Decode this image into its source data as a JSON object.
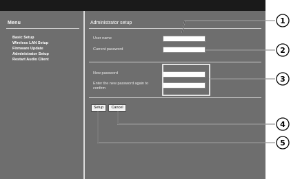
{
  "sidebar": {
    "title": "Menu",
    "items": [
      {
        "label": "Basic Setup"
      },
      {
        "label": "Wireless LAN Setup"
      },
      {
        "label": "Firmware Update"
      },
      {
        "label": "Administrator Setup"
      },
      {
        "label": "Restart Audio Client"
      }
    ]
  },
  "main": {
    "title": "Administrator setup",
    "fields": {
      "user_name": {
        "label": "User name",
        "value": ""
      },
      "current_password": {
        "label": "Current password",
        "value": ""
      },
      "new_password": {
        "label": "New password",
        "value": ""
      },
      "confirm_password": {
        "label_line1": "Enter the new password again to",
        "label_line2": "confirm",
        "value": ""
      }
    },
    "buttons": {
      "setup": "Setup",
      "cancel": "Cancel"
    }
  },
  "callouts": [
    "1",
    "2",
    "3",
    "4",
    "5"
  ],
  "colors": {
    "panel": "#6e6e6e",
    "frame": "#1a1a1a",
    "text": "#ffffff"
  }
}
